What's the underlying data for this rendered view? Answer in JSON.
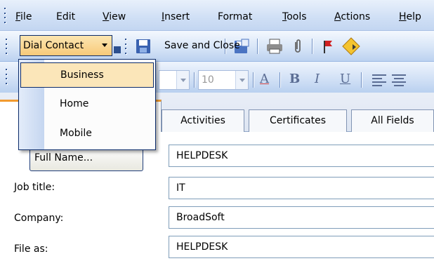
{
  "menubar": {
    "items": [
      {
        "label": "File",
        "mnemonic": "F"
      },
      {
        "label": "Edit"
      },
      {
        "label": "View",
        "mnemonic": "V"
      },
      {
        "label": "Insert",
        "mnemonic": "I"
      },
      {
        "label": "Format"
      },
      {
        "label": "Tools",
        "mnemonic": "T"
      },
      {
        "label": "Actions",
        "mnemonic": "A"
      },
      {
        "label": "Help",
        "mnemonic": "H"
      }
    ]
  },
  "toolbar": {
    "dial_contact_label": "Dial Contact",
    "save_and_close_label": "Save and Close",
    "icons": [
      "save-icon",
      "save-as-icon",
      "print-icon",
      "paperclip-icon",
      "flag-icon",
      "diamond-arrow-icon"
    ]
  },
  "formatting": {
    "font_size_value": "10",
    "buttons": [
      "A",
      "B",
      "I",
      "U"
    ]
  },
  "dial_menu": {
    "options": [
      "Business",
      "Home",
      "Mobile"
    ],
    "hovered": "Business"
  },
  "tabs": [
    "Activities",
    "Certificates",
    "All Fields"
  ],
  "form": {
    "full_name_button": "Full Name...",
    "full_name_value": "HELPDESK",
    "job_title_label": "Job title:",
    "job_title_value": "IT",
    "company_label": "Company:",
    "company_value": "BroadSoft",
    "file_as_label": "File as:",
    "file_as_value": "HELPDESK"
  },
  "colors": {
    "accent": "#f29b2f",
    "menu_highlight": "#fbe6b9",
    "toolbar_blue": "#cfdff5"
  }
}
